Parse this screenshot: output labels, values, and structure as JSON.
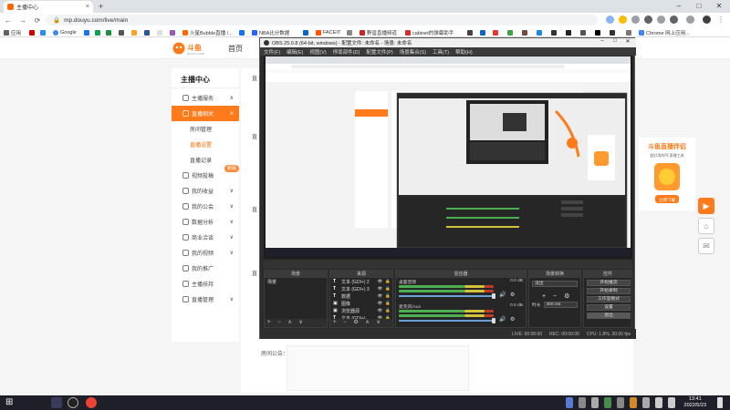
{
  "browser": {
    "tab_title": "主播中心",
    "url": "mp.douyu.com/live/main",
    "window_controls": [
      "–",
      "□",
      "✕"
    ],
    "bookmarks": [
      "应用",
      "Google",
      "火星Bubble直播 /...",
      "NBA比分数据",
      "FACEIT",
      "野兽直播频道",
      "cabinet的弹幕助手",
      "Chrome 网上应用..."
    ]
  },
  "site": {
    "logo_text": "斗鱼",
    "logo_sub": "DOUYU.COM",
    "home_link": "首页",
    "sidebar_title": "主播中心",
    "sidebar_items": [
      {
        "label": "主播服务",
        "chev": "∧"
      },
      {
        "label": "直播相关",
        "chev": "∧",
        "active": true
      },
      {
        "label": "房间管理",
        "sub": true
      },
      {
        "label": "直播设置",
        "sub": true,
        "on": true
      },
      {
        "label": "直播记录",
        "sub": true
      },
      {
        "label": "视频投稿",
        "badge": "新版"
      },
      {
        "label": "我的收益",
        "chev": "∨"
      },
      {
        "label": "我的公会",
        "chev": "∨"
      },
      {
        "label": "数据分析",
        "chev": "∨"
      },
      {
        "label": "商业洽谈",
        "chev": "∨"
      },
      {
        "label": "我的视频",
        "chev": "∨"
      },
      {
        "label": "我的推广"
      },
      {
        "label": "主播扶持"
      },
      {
        "label": "直播管理",
        "chev": "∨"
      }
    ],
    "notes_label": "房间公告：",
    "ad_title": "斗鱼直播伴侣",
    "ad_sub": "超好用的PC直播工具",
    "ad_btn": "立即下载"
  },
  "obs": {
    "title": "OBS 25.0.8 (64-bit, windows) - 配置文件: 未命名 - 场景: 未命名",
    "menu": [
      "文件(F)",
      "编辑(E)",
      "视图(V)",
      "停靠部件(D)",
      "配置文件(P)",
      "场景集合(S)",
      "工具(T)",
      "帮助(H)"
    ],
    "docks": {
      "scenes_header": "场景",
      "sources_header": "来源",
      "mixer_header": "混音器",
      "transitions_header": "场景转换",
      "controls_header": "控件"
    },
    "scene_item": "场景",
    "sources": [
      {
        "t": "T",
        "label": "文本 (GDI+) 2"
      },
      {
        "t": "T",
        "label": "文本 (GDI+) 3"
      },
      {
        "t": "T",
        "label": "数据"
      },
      {
        "t": "▣",
        "label": "图像"
      },
      {
        "t": "▣",
        "label": "浏览器源"
      },
      {
        "t": "T",
        "label": "文本 (GDI+)"
      }
    ],
    "mixer_tracks": [
      {
        "name": "桌面音频",
        "level": "0.0 dB"
      },
      {
        "name": "麦克风/Aux",
        "level": "0.0 dB"
      }
    ],
    "transition": "淡出",
    "duration_label": "时长",
    "duration_value": "300 ms",
    "controls": [
      "开始推流",
      "开始录制",
      "工作室模式",
      "设置",
      "退出"
    ],
    "status": {
      "live": "LIVE: 00:00:00",
      "rec": "REC: 00:00:00",
      "cpu": "CPU: 1.8%, 30.00 fps"
    }
  },
  "taskbar": {
    "time": "13:41",
    "date": "2022/5/23"
  },
  "colors": {
    "accent": "#ff7a1a",
    "obs_bg": "#2b2b2b",
    "meter_green": "#4caf50",
    "meter_yellow": "#d4c33a",
    "meter_red": "#c0392b"
  }
}
